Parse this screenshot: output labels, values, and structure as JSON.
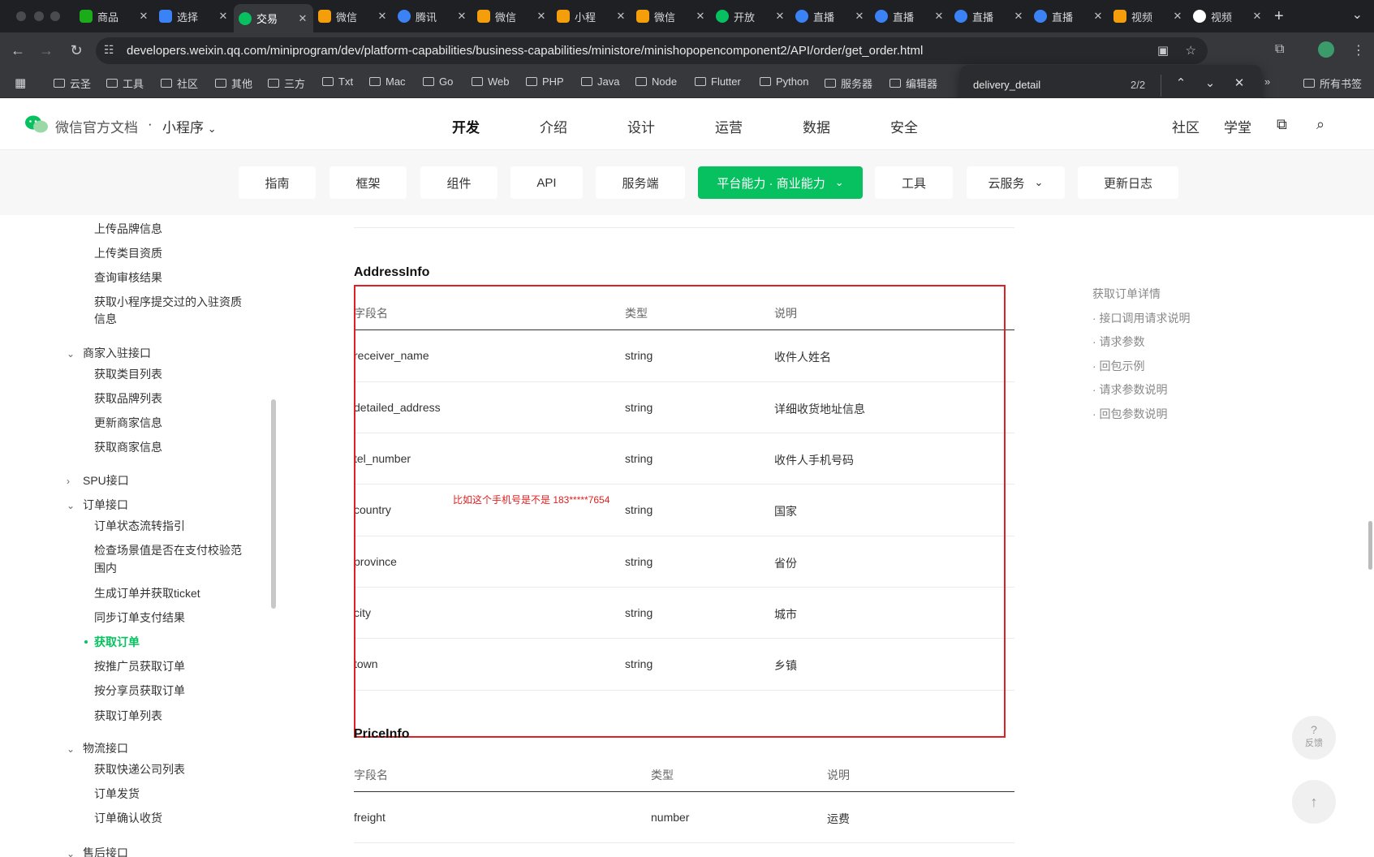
{
  "browser": {
    "tabs": [
      {
        "label": "商品",
        "color": "#1aad19"
      },
      {
        "label": "选择",
        "color": "#3b82f6"
      },
      {
        "label": "交易",
        "color": "#07c160",
        "active": true
      },
      {
        "label": "微信",
        "color": "#f59e0b"
      },
      {
        "label": "腾讯",
        "color": "#3b82f6"
      },
      {
        "label": "微信",
        "color": "#f59e0b"
      },
      {
        "label": "小程",
        "color": "#f59e0b"
      },
      {
        "label": "微信",
        "color": "#f59e0b"
      },
      {
        "label": "开放",
        "color": "#07c160"
      },
      {
        "label": "直播",
        "color": "#3b82f6"
      },
      {
        "label": "直播",
        "color": "#3b82f6"
      },
      {
        "label": "直播",
        "color": "#3b82f6"
      },
      {
        "label": "直播",
        "color": "#3b82f6"
      },
      {
        "label": "视频",
        "color": "#f59e0b"
      },
      {
        "label": "视频",
        "color": "#ffffff"
      }
    ],
    "tab_close": "✕",
    "new_tab": "+",
    "url": "developers.weixin.qq.com/miniprogram/dev/platform-capabilities/business-capabilities/ministore/minishopopencomponent2/API/order/get_order.html",
    "bookmarks": [
      "云圣",
      "工具",
      "社区",
      "其他",
      "三方",
      "Txt",
      "Mac",
      "Go",
      "Web",
      "PHP",
      "Java",
      "Node",
      "Flutter",
      "Python",
      "服务器",
      "编辑器"
    ],
    "all_bookmarks": "所有书签",
    "find": {
      "query": "delivery_detail",
      "count": "2/2"
    }
  },
  "site": {
    "brand": "微信官方文档",
    "dot": "·",
    "product": "小程序",
    "nav": [
      "开发",
      "介绍",
      "设计",
      "运营",
      "数据",
      "安全"
    ],
    "nav_active": "开发",
    "right": [
      "社区",
      "学堂"
    ]
  },
  "subnav": {
    "items": [
      "指南",
      "框架",
      "组件",
      "API",
      "服务端",
      "平台能力 · 商业能力",
      "工具",
      "云服务",
      "更新日志"
    ],
    "active": "平台能力 · 商业能力"
  },
  "sidebar": {
    "items": [
      {
        "label": "上传品牌信息"
      },
      {
        "label": "上传类目资质"
      },
      {
        "label": "查询审核结果"
      },
      {
        "label": "获取小程序提交过的入驻资质"
      },
      {
        "label": "信息"
      },
      {
        "label": "获取类目列表"
      },
      {
        "label": "获取品牌列表"
      },
      {
        "label": "更新商家信息"
      },
      {
        "label": "获取商家信息"
      },
      {
        "label": "订单状态流转指引"
      },
      {
        "label": "检查场景值是否在支付校验范"
      },
      {
        "label": "围内"
      },
      {
        "label": "生成订单并获取ticket"
      },
      {
        "label": "同步订单支付结果"
      },
      {
        "label": "获取订单"
      },
      {
        "label": "按推广员获取订单"
      },
      {
        "label": "按分享员获取订单"
      },
      {
        "label": "获取订单列表"
      },
      {
        "label": "获取快递公司列表"
      },
      {
        "label": "订单发货"
      },
      {
        "label": "订单确认收货"
      }
    ],
    "groups": [
      {
        "label": "商家入驻接口",
        "arrow": "⌄"
      },
      {
        "label": "SPU接口",
        "arrow": "›"
      },
      {
        "label": "订单接口",
        "arrow": "⌄"
      },
      {
        "label": "物流接口",
        "arrow": "⌄"
      },
      {
        "label": "售后接口",
        "arrow": "⌄"
      }
    ]
  },
  "content": {
    "address_title": "AddressInfo",
    "headers": [
      "字段名",
      "类型",
      "说明"
    ],
    "address_rows": [
      [
        "receiver_name",
        "string",
        "收件人姓名"
      ],
      [
        "detailed_address",
        "string",
        "详细收货地址信息"
      ],
      [
        "tel_number",
        "string",
        "收件人手机号码"
      ],
      [
        "country",
        "string",
        "国家"
      ],
      [
        "province",
        "string",
        "省份"
      ],
      [
        "city",
        "string",
        "城市"
      ],
      [
        "town",
        "string",
        "乡镇"
      ]
    ],
    "annotation": "比如这个手机号是不是 183*****7654",
    "price_title": "PriceInfo",
    "price_rows": [
      [
        "freight",
        "number",
        "运费"
      ]
    ]
  },
  "toc": {
    "title": "获取订单详情",
    "items": [
      "· 接口调用请求说明",
      "· 请求参数",
      "· 回包示例",
      "· 请求参数说明",
      "· 回包参数说明"
    ]
  },
  "floaters": {
    "feedback": "反馈",
    "feedback_icon": "?",
    "top_icon": "↑"
  },
  "colors": {
    "accent": "#07c160",
    "annotation": "#e02020"
  }
}
